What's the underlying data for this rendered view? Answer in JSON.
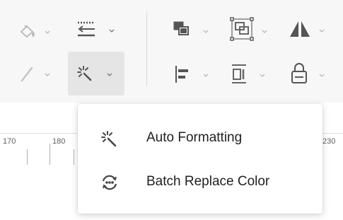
{
  "toolbar": {
    "row1": [
      "fill-icon",
      "line-style-icon",
      "arrange-icon",
      "group-icon",
      "flip-icon"
    ],
    "row2": [
      "pen-icon",
      "auto-format-icon",
      "align-left-icon",
      "distribute-icon",
      "lock-icon"
    ],
    "icon_color": "#555555",
    "disabled_color": "#b8b8b8",
    "active_bg": "#e5e5e5"
  },
  "ruler": {
    "labels": [
      "170",
      "180",
      "230"
    ]
  },
  "menu": {
    "items": [
      {
        "label": "Auto Formatting",
        "icon": "auto-format-icon"
      },
      {
        "label": "Batch Replace Color",
        "icon": "batch-replace-color-icon"
      }
    ]
  }
}
